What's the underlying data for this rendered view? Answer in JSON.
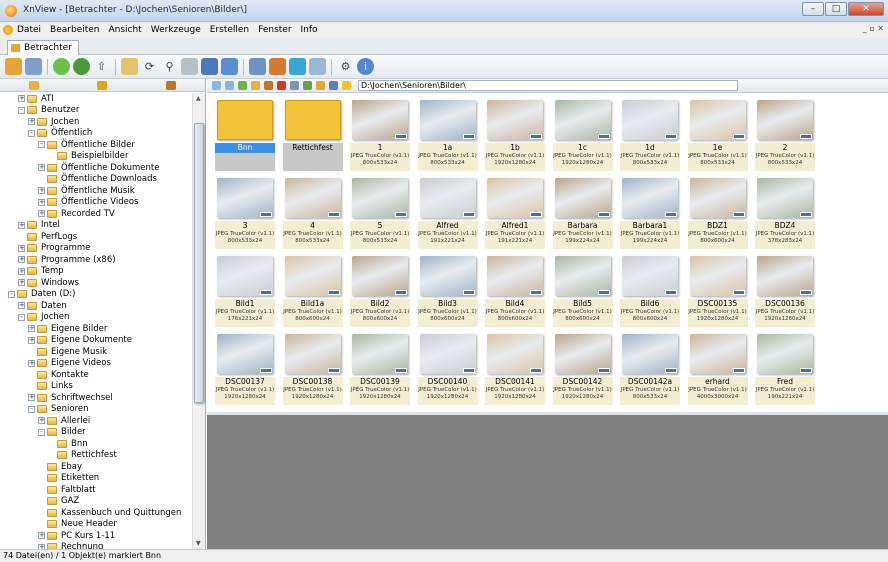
{
  "window": {
    "title": "XnView - [Betrachter - D:\\Jochen\\Senioren\\Bilder\\]",
    "min": "–",
    "max": "□",
    "close": "✕"
  },
  "menu": [
    "Datei",
    "Bearbeiten",
    "Ansicht",
    "Werkzeuge",
    "Erstellen",
    "Fenster",
    "Info"
  ],
  "mdi_controls": "_ ▫ ✕",
  "tab": "Betrachter",
  "path": "D:\\Jochen\\Senioren\\Bilder\\",
  "tree": [
    {
      "label": "ATI",
      "level": 3,
      "pm": "+"
    },
    {
      "label": "Benutzer",
      "level": 3,
      "pm": "-"
    },
    {
      "label": "Jochen",
      "level": 4,
      "pm": "+"
    },
    {
      "label": "Öffentlich",
      "level": 4,
      "pm": "-"
    },
    {
      "label": "Öffentliche Bilder",
      "level": 5,
      "pm": "-"
    },
    {
      "label": "Beispielbilder",
      "level": 6,
      "pm": ""
    },
    {
      "label": "Öffentliche Dokumente",
      "level": 5,
      "pm": "+"
    },
    {
      "label": "Öffentliche Downloads",
      "level": 5,
      "pm": ""
    },
    {
      "label": "Öffentliche Musik",
      "level": 5,
      "pm": "+"
    },
    {
      "label": "Öffentliche Videos",
      "level": 5,
      "pm": "+"
    },
    {
      "label": "Recorded TV",
      "level": 5,
      "pm": "+"
    },
    {
      "label": "Intel",
      "level": 3,
      "pm": "+"
    },
    {
      "label": "PerfLogs",
      "level": 3,
      "pm": ""
    },
    {
      "label": "Programme",
      "level": 3,
      "pm": "+"
    },
    {
      "label": "Programme (x86)",
      "level": 3,
      "pm": "+"
    },
    {
      "label": "Temp",
      "level": 3,
      "pm": "+"
    },
    {
      "label": "Windows",
      "level": 3,
      "pm": "+"
    },
    {
      "label": "Daten (D:)",
      "level": 2,
      "pm": "-"
    },
    {
      "label": "Daten",
      "level": 3,
      "pm": "+"
    },
    {
      "label": "Jochen",
      "level": 3,
      "pm": "-"
    },
    {
      "label": "Eigene Bilder",
      "level": 4,
      "pm": "+"
    },
    {
      "label": "Eigene Dokumente",
      "level": 4,
      "pm": "+"
    },
    {
      "label": "Eigene Musik",
      "level": 4,
      "pm": ""
    },
    {
      "label": "Eigene Videos",
      "level": 4,
      "pm": "+"
    },
    {
      "label": "Kontakte",
      "level": 4,
      "pm": ""
    },
    {
      "label": "Links",
      "level": 4,
      "pm": ""
    },
    {
      "label": "Schriftwechsel",
      "level": 4,
      "pm": "+"
    },
    {
      "label": "Senioren",
      "level": 4,
      "pm": "-"
    },
    {
      "label": "Allerlei",
      "level": 5,
      "pm": "+"
    },
    {
      "label": "Bilder",
      "level": 5,
      "pm": "-"
    },
    {
      "label": "Bnn",
      "level": 6,
      "pm": ""
    },
    {
      "label": "Rettichfest",
      "level": 6,
      "pm": ""
    },
    {
      "label": "Ebay",
      "level": 5,
      "pm": ""
    },
    {
      "label": "Etiketten",
      "level": 5,
      "pm": ""
    },
    {
      "label": "Faltblatt",
      "level": 5,
      "pm": ""
    },
    {
      "label": "GAZ",
      "level": 5,
      "pm": ""
    },
    {
      "label": "Kassenbuch und Quittungen",
      "level": 5,
      "pm": ""
    },
    {
      "label": "Neue Header",
      "level": 5,
      "pm": ""
    },
    {
      "label": "PC Kurs 1-11",
      "level": 5,
      "pm": "+"
    },
    {
      "label": "Rechnung",
      "level": 5,
      "pm": "+"
    }
  ],
  "thumbs": [
    {
      "name": "Bnn",
      "sub": "",
      "folder": true,
      "selected": true
    },
    {
      "name": "Rettichfest",
      "sub": "",
      "folder": true
    },
    {
      "name": "1",
      "sub": "JPEG TrueColor (v1.1)|800x533x24"
    },
    {
      "name": "1a",
      "sub": "JPEG TrueColor (v1.1)|800x533x24"
    },
    {
      "name": "1b",
      "sub": "JPEG TrueColor (v1.1)|1920x1280x24"
    },
    {
      "name": "1c",
      "sub": "JPEG TrueColor (v1.1)|1920x1280x24"
    },
    {
      "name": "1d",
      "sub": "JPEG TrueColor (v1.1)|800x533x24"
    },
    {
      "name": "1e",
      "sub": "JPEG TrueColor (v1.1)|800x533x24"
    },
    {
      "name": "2",
      "sub": "JPEG TrueColor (v1.1)|800x533x24"
    },
    {
      "name": "3",
      "sub": "JPEG TrueColor (v1.1)|800x533x24"
    },
    {
      "name": "4",
      "sub": "JPEG TrueColor (v1.1)|800x533x24"
    },
    {
      "name": "5",
      "sub": "JPEG TrueColor (v1.1)|800x533x24"
    },
    {
      "name": "Alfred",
      "sub": "JPEG TrueColor (v1.1)|191x221x24"
    },
    {
      "name": "Alfred1",
      "sub": "JPEG TrueColor (v1.1)|191x221x24"
    },
    {
      "name": "Barbara",
      "sub": "JPEG TrueColor (v1.1)|199x224x24"
    },
    {
      "name": "Barbara1",
      "sub": "JPEG TrueColor (v1.1)|199x224x24"
    },
    {
      "name": "BDZ1",
      "sub": "JPEG TrueColor (v1.1)|800x600x24"
    },
    {
      "name": "BDZ4",
      "sub": "JPEG TrueColor (v1.1)|378x283x24"
    },
    {
      "name": "Bild1",
      "sub": "JPEG TrueColor (v1.1)|176x221x24"
    },
    {
      "name": "Bild1a",
      "sub": "JPEG TrueColor (v1.1)|800x600x24"
    },
    {
      "name": "Bild2",
      "sub": "JPEG TrueColor (v1.1)|800x600x24"
    },
    {
      "name": "Bild3",
      "sub": "JPEG TrueColor (v1.1)|800x600x24"
    },
    {
      "name": "Bild4",
      "sub": "JPEG TrueColor (v1.1)|800x600x24"
    },
    {
      "name": "Bild5",
      "sub": "JPEG TrueColor (v1.1)|800x600x24"
    },
    {
      "name": "Bild6",
      "sub": "JPEG TrueColor (v1.1)|800x600x24"
    },
    {
      "name": "DSC00135",
      "sub": "JPEG TrueColor (v1.1)|1920x1280x24"
    },
    {
      "name": "DSC00136",
      "sub": "JPEG TrueColor (v1.1)|1920x1280x24"
    },
    {
      "name": "DSC00137",
      "sub": "JPEG TrueColor (v1.1)|1920x1280x24"
    },
    {
      "name": "DSC00138",
      "sub": "JPEG TrueColor (v1.1)|1920x1280x24"
    },
    {
      "name": "DSC00139",
      "sub": "JPEG TrueColor (v1.1)|1920x1280x24"
    },
    {
      "name": "DSC00140",
      "sub": "JPEG TrueColor (v1.1)|1920x1280x24"
    },
    {
      "name": "DSC00141",
      "sub": "JPEG TrueColor (v1.1)|1920x1280x24"
    },
    {
      "name": "DSC00142",
      "sub": "JPEG TrueColor (v1.1)|1920x1280x24"
    },
    {
      "name": "DSC00142a",
      "sub": "JPEG TrueColor (v1.1)|800x533x24"
    },
    {
      "name": "erhard",
      "sub": "JPEG TrueColor (v1.1)|4000x3000x24"
    },
    {
      "name": "Fred",
      "sub": "JPEG TrueColor (v1.1)|190x221x24"
    }
  ],
  "status": "74 Datei(en) / 1 Objekt(e) markiert  Bnn"
}
